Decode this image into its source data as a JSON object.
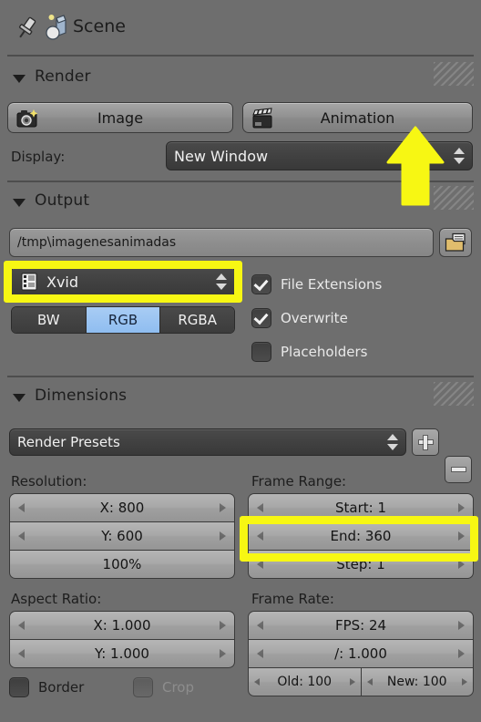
{
  "header": {
    "pin_icon": "pin-icon",
    "scene_icon": "scene-icon",
    "scene_label": "Scene"
  },
  "render_panel": {
    "title": "Render",
    "collapse_icon": "triangle-down-icon",
    "image_button": {
      "label": "Image",
      "icon": "camera-icon"
    },
    "animation_button": {
      "label": "Animation",
      "icon": "clapperboard-icon"
    },
    "display": {
      "label": "Display:",
      "value": "New Window",
      "icon": "updown-chevron-icon"
    }
  },
  "output_panel": {
    "title": "Output",
    "collapse_icon": "triangle-down-icon",
    "path": {
      "value": "/tmp\\imagenesanimadas",
      "browse_icon": "folder-icon"
    },
    "format": {
      "value": "Xvid",
      "icon": "movie-film-icon",
      "chevron_icon": "updown-chevron-icon"
    },
    "color_modes": [
      "BW",
      "RGB",
      "RGBA"
    ],
    "color_mode_selected": "RGB",
    "checkboxes": [
      {
        "label": "File Extensions",
        "checked": true,
        "enabled": true
      },
      {
        "label": "Overwrite",
        "checked": true,
        "enabled": true
      },
      {
        "label": "Placeholders",
        "checked": false,
        "enabled": true
      }
    ]
  },
  "dimensions_panel": {
    "title": "Dimensions",
    "collapse_icon": "triangle-down-icon",
    "presets": {
      "value": "Render Presets",
      "chevron_icon": "updown-chevron-icon",
      "add_icon": "plus-icon",
      "remove_icon": "minus-icon"
    },
    "resolution": {
      "label": "Resolution:",
      "x": "X: 800",
      "y": "Y: 600",
      "percent": "100%"
    },
    "frame_range": {
      "label": "Frame Range:",
      "start": "Start: 1",
      "end": "End: 360",
      "step": "Step: 1"
    },
    "aspect_ratio": {
      "label": "Aspect Ratio:",
      "x": "X: 1.000",
      "y": "Y: 1.000"
    },
    "frame_rate": {
      "label": "Frame Rate:",
      "fps": "FPS: 24",
      "divider": "/: 1.000",
      "old": "Old: 100",
      "new": "New: 100"
    },
    "border_checkbox": {
      "label": "Border",
      "checked": false,
      "enabled": true
    },
    "crop_checkbox": {
      "label": "Crop",
      "checked": false,
      "enabled": false
    }
  },
  "annotations": {
    "highlight_color": "#f7f713",
    "arrow_color": "#f7f713",
    "highlights": [
      {
        "name": "format-dropdown-highlight",
        "target": "Xvid"
      },
      {
        "name": "end-frame-highlight",
        "target": "End: 360"
      }
    ],
    "arrows": [
      {
        "name": "animation-button-arrow",
        "target": "Animation"
      }
    ]
  },
  "theme": {
    "panel_bg": "#6e6e6e",
    "accent_blue": "#8fbdf0",
    "text_dark": "#1d1d1d",
    "text_light": "#f0f0f0"
  }
}
